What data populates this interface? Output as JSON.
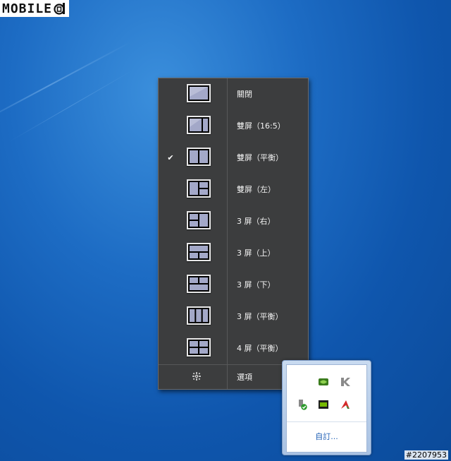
{
  "logo": {
    "text": "MOBILE",
    "icon": "mobile01-logo-icon"
  },
  "watermark": "#2207953",
  "menu": {
    "selected_index": 2,
    "items": [
      {
        "label": "關閉",
        "icon": "layout-single-icon"
      },
      {
        "label": "雙屏（16:5）",
        "icon": "layout-split-16-5-icon"
      },
      {
        "label": "雙屏（平衡）",
        "icon": "layout-split-even-icon"
      },
      {
        "label": "雙屏（左）",
        "icon": "layout-split-left-icon"
      },
      {
        "label": "3 屏（右）",
        "icon": "layout-three-right-icon"
      },
      {
        "label": "3 屏（上）",
        "icon": "layout-three-top-icon"
      },
      {
        "label": "3 屏（下）",
        "icon": "layout-three-bottom-icon"
      },
      {
        "label": "3 屏（平衡）",
        "icon": "layout-three-even-icon"
      },
      {
        "label": "4 屏（平衡）",
        "icon": "layout-four-even-icon"
      }
    ],
    "check_mark": "✔",
    "options_label": "選項",
    "options_arrow": "▶"
  },
  "tray": {
    "icons": [
      "nvidia-green-icon",
      "k-app-icon",
      "usb-safe-remove-icon",
      "nvidia-display-icon",
      "red-arrow-app-icon"
    ],
    "customize_label": "自訂..."
  },
  "colors": {
    "menu_bg": "#3c3d3e",
    "pane_fill": "#a3a8c8",
    "desktop": "#1d6cc4"
  }
}
